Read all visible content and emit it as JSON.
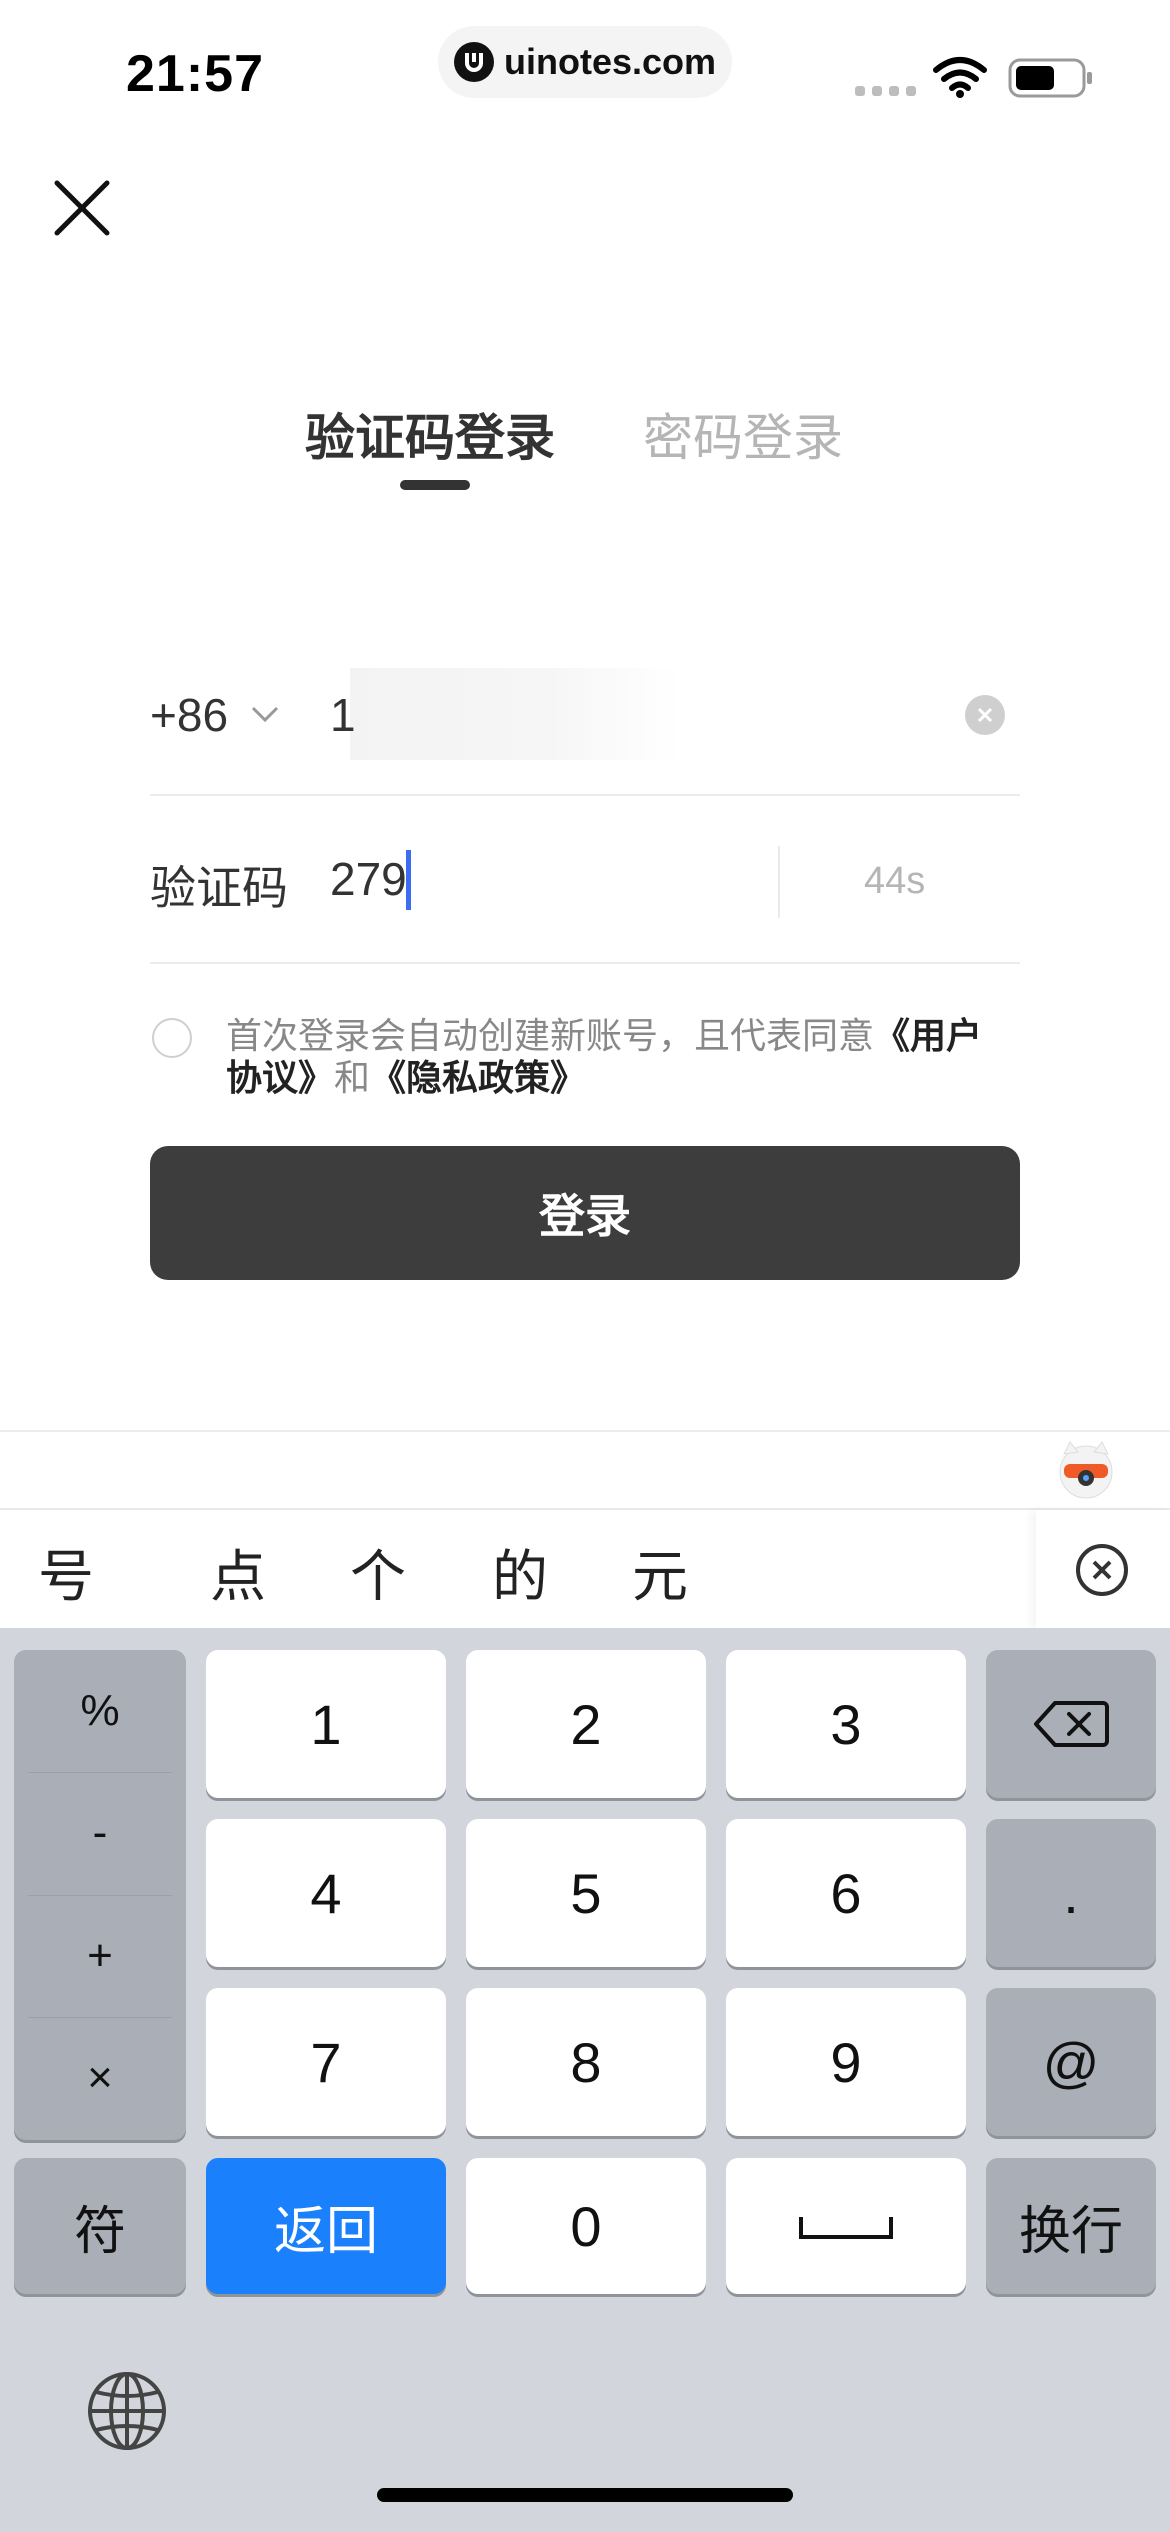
{
  "status_bar": {
    "time": "21:57",
    "url": "uinotes.com"
  },
  "tabs": [
    {
      "label": "验证码登录",
      "active": true
    },
    {
      "label": "密码登录",
      "active": false
    }
  ],
  "phone": {
    "country_code": "+86",
    "value": "1"
  },
  "code": {
    "label": "验证码",
    "value": "279",
    "countdown": "44s"
  },
  "agreement": {
    "text_before": "首次登录会自动创建新账号，且代表同意",
    "user_agreement": "《用户协议》",
    "and": "和",
    "privacy_policy": "《隐私政策》"
  },
  "login_button": "登录",
  "candidates": [
    "号",
    "点",
    "个",
    "的",
    "元"
  ],
  "keyboard": {
    "symbols": [
      "%",
      "-",
      "+",
      "×"
    ],
    "digits": [
      "1",
      "2",
      "3",
      "4",
      "5",
      "6",
      "7",
      "8",
      "9",
      "0"
    ],
    "period": ".",
    "at": "@",
    "symbol_key": "符",
    "return_key": "返回",
    "newline_key": "换行"
  },
  "colors": {
    "accent_blue": "#1a80fc",
    "caret": "#3a6cf4",
    "button_dark": "#3d3d3d"
  }
}
